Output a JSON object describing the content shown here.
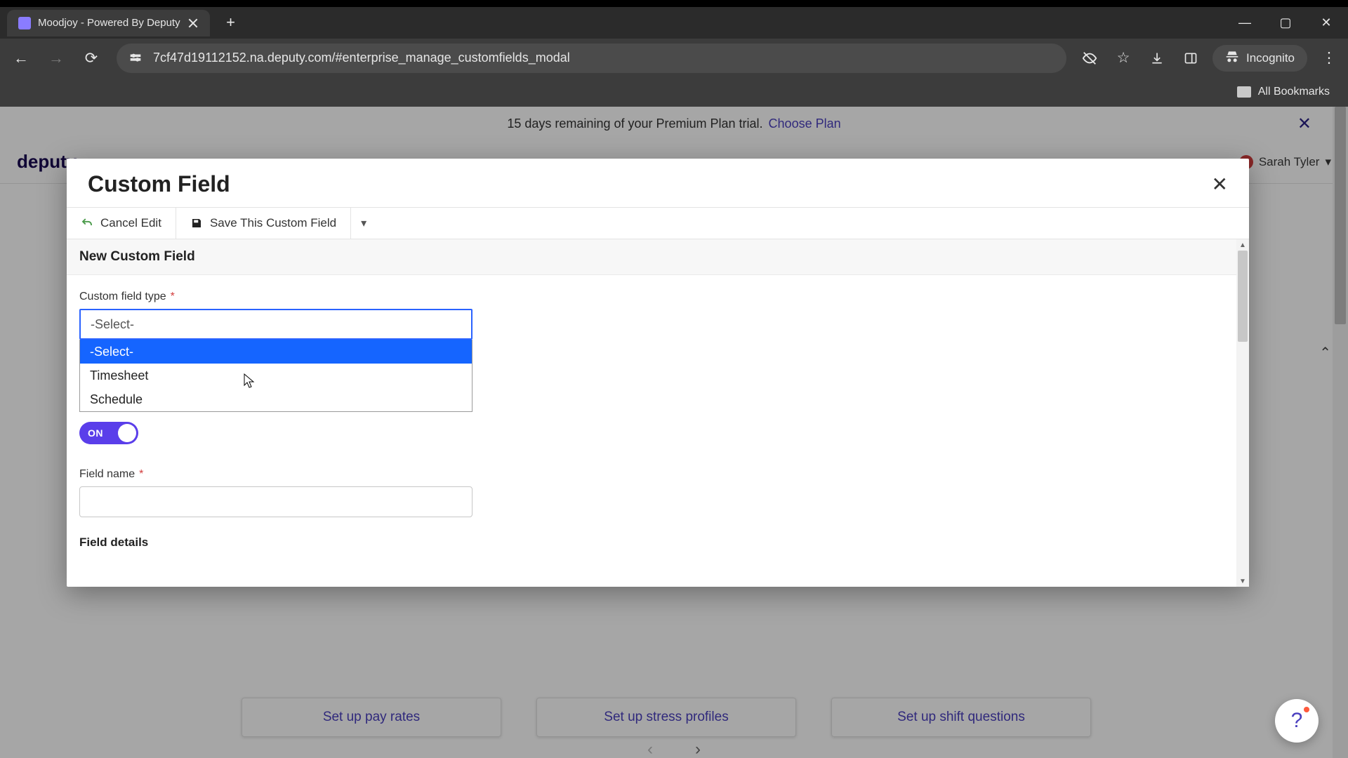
{
  "browser": {
    "tab_title": "Moodjoy - Powered By Deputy",
    "url": "7cf47d19112152.na.deputy.com/#enterprise_manage_customfields_modal",
    "incognito_label": "Incognito",
    "all_bookmarks": "All Bookmarks"
  },
  "page": {
    "trial_text": "15 days remaining of your Premium Plan trial.",
    "choose_plan": "Choose Plan",
    "logo": "deputy",
    "user_name": "Sarah Tyler",
    "bg_buttons": [
      "Set up pay rates",
      "Set up stress profiles",
      "Set up shift questions"
    ]
  },
  "modal": {
    "title": "Custom Field",
    "cancel": "Cancel Edit",
    "save": "Save This Custom Field",
    "subheader": "New Custom Field",
    "field_type_label": "Custom field type",
    "select_placeholder": "-Select-",
    "dropdown_options": [
      "-Select-",
      "Timesheet",
      "Schedule"
    ],
    "toggle_label": "ON",
    "field_name_label": "Field name",
    "field_name_value": "",
    "field_details": "Field details"
  }
}
